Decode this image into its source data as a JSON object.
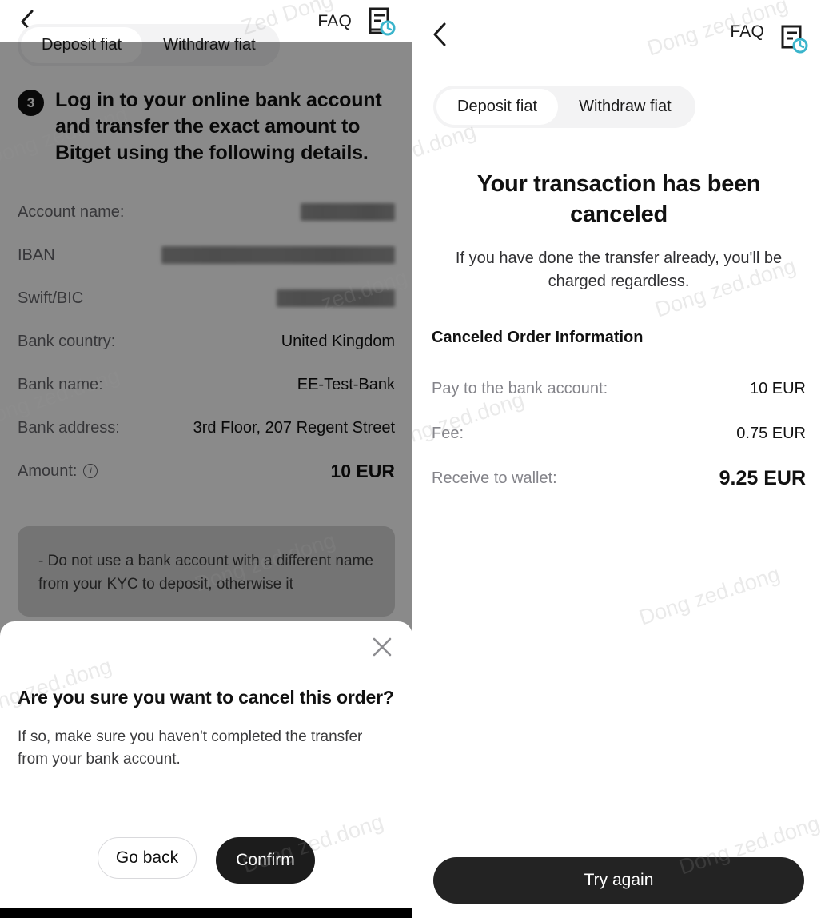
{
  "left_screen": {
    "header": {
      "back_icon": "chevron-left-icon",
      "faq_label": "FAQ",
      "orders_icon": "document-clock-icon"
    },
    "tabs": [
      {
        "label": "Deposit fiat",
        "active": true
      },
      {
        "label": "Withdraw fiat",
        "active": false
      }
    ],
    "step": {
      "number": "3",
      "text": "Log in to your online bank account and transfer the exact amount to Bitget using the following details."
    },
    "details": [
      {
        "key": "Account name:",
        "value": "",
        "redacted": true
      },
      {
        "key": "IBAN",
        "value": "",
        "redacted": true
      },
      {
        "key": "Swift/BIC",
        "value": "",
        "redacted": true
      },
      {
        "key": "Bank country:",
        "value": "United Kingdom",
        "redacted": false
      },
      {
        "key": "Bank name:",
        "value": "EE-Test-Bank",
        "redacted": false
      },
      {
        "key": "Bank address:",
        "value": "3rd Floor, 207 Regent Street",
        "redacted": false
      },
      {
        "key": "Amount:",
        "value": "10 EUR",
        "redacted": false,
        "info_icon": true,
        "bold": true
      }
    ],
    "note": "- Do not use a bank account with a different name from your KYC to deposit, otherwise it",
    "modal": {
      "close_icon": "close-x-icon",
      "title": "Are you sure you want to cancel this order?",
      "subtitle": "If so, make sure you haven't completed the transfer from your bank account.",
      "go_back_label": "Go back",
      "confirm_label": "Confirm"
    }
  },
  "right_screen": {
    "header": {
      "back_icon": "chevron-left-icon",
      "faq_label": "FAQ",
      "orders_icon": "document-clock-icon"
    },
    "tabs": [
      {
        "label": "Deposit fiat",
        "active": true
      },
      {
        "label": "Withdraw fiat",
        "active": false
      }
    ],
    "title": "Your transaction has been canceled",
    "subtitle": "If you have done the transfer already, you'll be charged regardless.",
    "section_heading": "Canceled Order Information",
    "rows": [
      {
        "key": "Pay to the bank account:",
        "value": "10 EUR",
        "emphasis": false
      },
      {
        "key": "Fee:",
        "value": "0.75 EUR",
        "emphasis": false
      },
      {
        "key": "Receive to wallet:",
        "value": "9.25 EUR",
        "emphasis": true
      }
    ],
    "try_again_label": "Try again"
  },
  "watermark": {
    "text_a": "Zed Dong",
    "text_b": "zed.dong",
    "text_c": "Dong zed.dong"
  },
  "colors": {
    "accent_teal": "#3bb5cc",
    "dark": "#1c1c1c",
    "muted": "#84848a",
    "tab_bg": "#f3f3f4"
  }
}
